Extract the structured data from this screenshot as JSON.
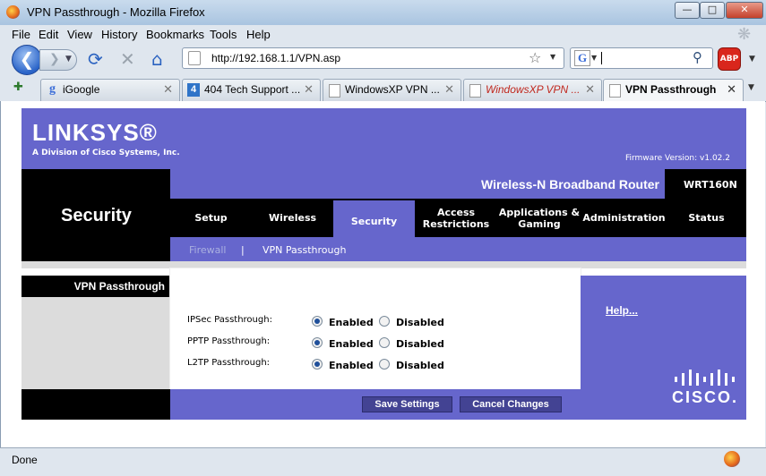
{
  "window": {
    "title": "VPN Passthrough - Mozilla Firefox"
  },
  "menu": [
    "File",
    "Edit",
    "View",
    "History",
    "Bookmarks",
    "Tools",
    "Help"
  ],
  "nav": {
    "url": "http://192.168.1.1/VPN.asp",
    "search_value": ""
  },
  "tabs": [
    {
      "label": "iGoogle"
    },
    {
      "label": "404 Tech Support ..."
    },
    {
      "label": "WindowsXP VPN ..."
    },
    {
      "label": "WindowsXP VPN ..."
    },
    {
      "label": "VPN Passthrough"
    }
  ],
  "page": {
    "logo": "LINKSYS®",
    "logo_sub": "A Division of Cisco Systems, Inc.",
    "firmware": "Firmware Version: v1.02.2",
    "section": "Security",
    "product": "Wireless-N Broadband Router",
    "model": "WRT160N",
    "main_tabs": [
      "Setup",
      "Wireless",
      "Security",
      "Access Restrictions",
      "Applications & Gaming",
      "Administration",
      "Status"
    ],
    "sub_tabs": [
      "Firewall",
      "|",
      "VPN Passthrough"
    ],
    "left_label": "VPN Passthrough",
    "rows": [
      {
        "label": "IPSec Passthrough:",
        "value": "Enabled"
      },
      {
        "label": "PPTP Passthrough:",
        "value": "Enabled"
      },
      {
        "label": "L2TP Passthrough:",
        "value": "Enabled"
      }
    ],
    "option_enabled": "Enabled",
    "option_disabled": "Disabled",
    "help": "Help...",
    "cisco": "CISCO.",
    "save": "Save Settings",
    "cancel": "Cancel Changes"
  },
  "status": {
    "text": "Done"
  },
  "colors": {
    "linksys_purple": "#6666cc",
    "abp_red": "#d9261c"
  }
}
